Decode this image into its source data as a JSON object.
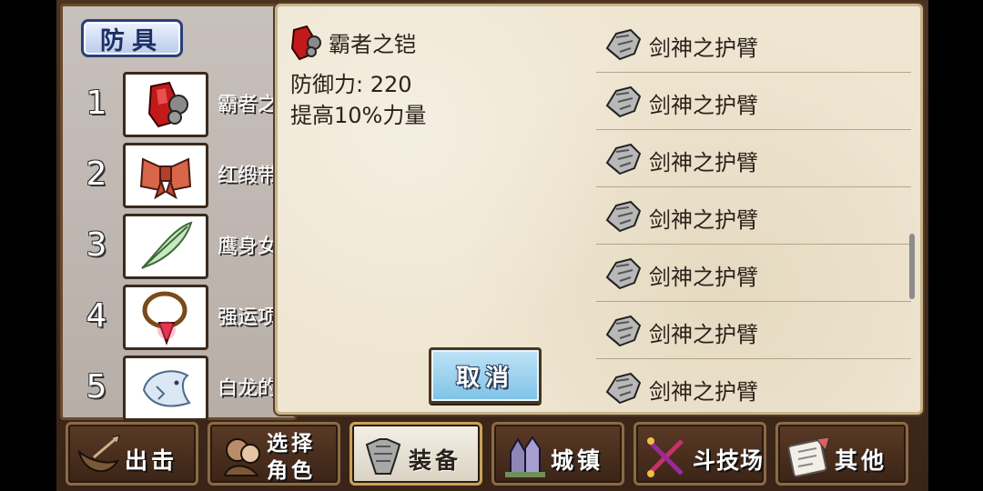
{
  "armor_panel": {
    "title": "防具",
    "slots": [
      {
        "num": "1",
        "name": "霸者之",
        "icon": "red-armor-icon"
      },
      {
        "num": "2",
        "name": "红缎带",
        "icon": "ribbon-icon"
      },
      {
        "num": "3",
        "name": "鹰身女",
        "icon": "feather-icon"
      },
      {
        "num": "4",
        "name": "强运项",
        "icon": "necklace-icon"
      },
      {
        "num": "5",
        "name": "白龙的",
        "icon": "dragon-icon"
      }
    ]
  },
  "detail": {
    "name": "霸者之铠",
    "defense": "防御力: 220",
    "effect": "提高10%力量",
    "cancel_label": "取消"
  },
  "item_list": [
    {
      "label": "剑神之护臂",
      "icon": "gauntlet-icon"
    },
    {
      "label": "剑神之护臂",
      "icon": "gauntlet-icon"
    },
    {
      "label": "剑神之护臂",
      "icon": "gauntlet-icon"
    },
    {
      "label": "剑神之护臂",
      "icon": "gauntlet-icon"
    },
    {
      "label": "剑神之护臂",
      "icon": "gauntlet-icon"
    },
    {
      "label": "剑神之护臂",
      "icon": "gauntlet-icon"
    },
    {
      "label": "剑神之护臂",
      "icon": "gauntlet-icon"
    }
  ],
  "nav": [
    {
      "label": "出击",
      "icon": "sortie-icon",
      "active": false
    },
    {
      "label": "选择\n角色",
      "icon": "character-icon",
      "active": false
    },
    {
      "label": "装备",
      "icon": "equipment-icon",
      "active": true
    },
    {
      "label": "城镇",
      "icon": "town-icon",
      "active": false
    },
    {
      "label": "斗技场",
      "icon": "arena-icon",
      "active": false
    },
    {
      "label": "其他",
      "icon": "other-icon",
      "active": false
    }
  ],
  "colors": {
    "panel_bg": "#efe6d2",
    "cancel_button": "#7ec2e6",
    "title_border": "#2b3f78",
    "frame": "#5a3b22"
  }
}
